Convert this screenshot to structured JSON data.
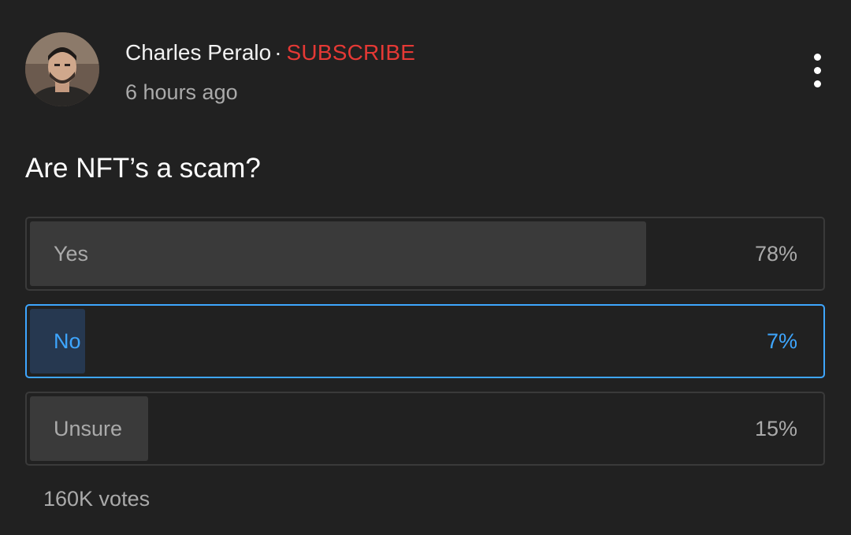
{
  "post": {
    "author": "Charles Peralo",
    "separator": "·",
    "subscribe_label": "SUBSCRIBE",
    "timestamp": "6 hours ago",
    "menu_icon": "more-vert-icon"
  },
  "poll": {
    "question": "Are NFT’s a scam?",
    "options": [
      {
        "label": "Yes",
        "percent_text": "78%",
        "percent": 78,
        "selected": false
      },
      {
        "label": "No",
        "percent_text": "7%",
        "percent": 7,
        "selected": true
      },
      {
        "label": "Unsure",
        "percent_text": "15%",
        "percent": 15,
        "selected": false
      }
    ],
    "votes": "160K votes"
  },
  "colors": {
    "background": "#212121",
    "subscribe": "#e53935",
    "selected_accent": "#3ea6ff",
    "bar_fill": "#3a3a3a",
    "selected_fill": "#263850",
    "secondary_text": "#aaaaaa"
  }
}
